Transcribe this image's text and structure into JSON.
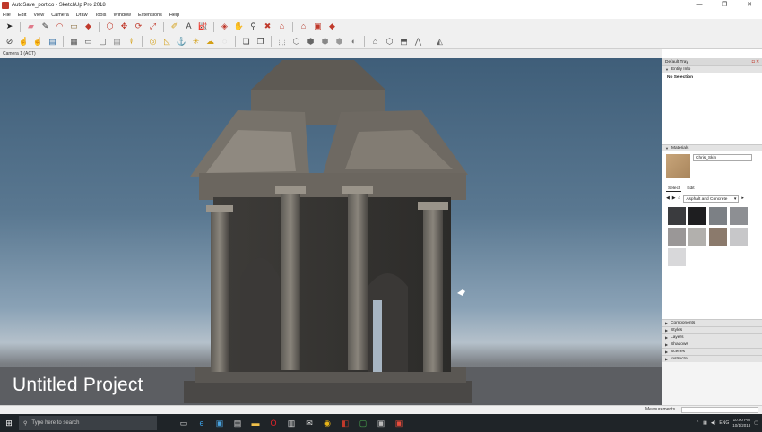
{
  "window": {
    "title": "AutoSave_portico - SketchUp Pro 2018",
    "controls": [
      "—",
      "❐",
      "✕"
    ]
  },
  "menu": [
    "File",
    "Edit",
    "View",
    "Camera",
    "Draw",
    "Tools",
    "Window",
    "Extensions",
    "Help"
  ],
  "toolbar_row1": [
    {
      "icon": "select-arrow-icon",
      "glyph": "➤",
      "color": "#222"
    },
    {
      "icon": "eraser-icon",
      "glyph": "▰",
      "color": "#e07a8a"
    },
    {
      "icon": "pencil-icon",
      "glyph": "✎",
      "color": "#333"
    },
    {
      "icon": "arc-icon",
      "glyph": "◠",
      "color": "#c0392b"
    },
    {
      "icon": "rectangle-icon",
      "glyph": "▭",
      "color": "#8a6d3b"
    },
    {
      "icon": "push-pull-icon",
      "glyph": "◆",
      "color": "#c0392b"
    },
    {
      "icon": "offset-icon",
      "glyph": "⬡",
      "color": "#c0392b"
    },
    {
      "icon": "move-icon",
      "glyph": "✥",
      "color": "#c0392b"
    },
    {
      "icon": "rotate-icon",
      "glyph": "⟳",
      "color": "#c0392b"
    },
    {
      "icon": "scale-icon",
      "glyph": "⤢",
      "color": "#c0392b"
    },
    {
      "icon": "tape-measure-icon",
      "glyph": "✐",
      "color": "#d4a017"
    },
    {
      "icon": "text-icon",
      "glyph": "A",
      "color": "#444"
    },
    {
      "icon": "paint-bucket-icon",
      "glyph": "⛽",
      "color": "#d35400"
    },
    {
      "icon": "orbit-icon",
      "glyph": "◈",
      "color": "#c0392b"
    },
    {
      "icon": "pan-icon",
      "glyph": "✋",
      "color": "#444"
    },
    {
      "icon": "zoom-icon",
      "glyph": "⚲",
      "color": "#444"
    },
    {
      "icon": "zoom-extents-icon",
      "glyph": "✖",
      "color": "#c0392b"
    },
    {
      "icon": "warehouse-icon",
      "glyph": "⌂",
      "color": "#c0392b"
    },
    {
      "icon": "extension-warehouse-icon",
      "glyph": "⌂",
      "color": "#b03a2e"
    },
    {
      "icon": "layout-icon",
      "glyph": "▣",
      "color": "#c0392b"
    },
    {
      "icon": "ruby-icon",
      "glyph": "◆",
      "color": "#c0392b"
    }
  ],
  "toolbar_row2": [
    {
      "icon": "walk-icon",
      "glyph": "⊘",
      "color": "#444"
    },
    {
      "icon": "hand-icon",
      "glyph": "☝",
      "color": "#444"
    },
    {
      "icon": "hand-select-icon",
      "glyph": "☝",
      "color": "#2e6da4"
    },
    {
      "icon": "section-plane-icon",
      "glyph": "▤",
      "color": "#2e6da4"
    },
    {
      "icon": "display-section-icon",
      "glyph": "▦",
      "color": "#555"
    },
    {
      "icon": "window-icon",
      "glyph": "▭",
      "color": "#555"
    },
    {
      "icon": "frame-icon",
      "glyph": "▢",
      "color": "#555"
    },
    {
      "icon": "lock-icon",
      "glyph": "▤",
      "color": "#888"
    },
    {
      "icon": "funnel-icon",
      "glyph": "⍒",
      "color": "#d4a017"
    },
    {
      "icon": "circle-target-icon",
      "glyph": "◎",
      "color": "#d4a017"
    },
    {
      "icon": "triangle-ruler-icon",
      "glyph": "◺",
      "color": "#d4a017"
    },
    {
      "icon": "anchor-icon",
      "glyph": "⚓",
      "color": "#d4a017"
    },
    {
      "icon": "spark-icon",
      "glyph": "✳",
      "color": "#d4a017"
    },
    {
      "icon": "cloud-icon",
      "glyph": "☁",
      "color": "#d4a017"
    },
    {
      "icon": "ring-icon",
      "glyph": "◌",
      "color": "#bbb"
    },
    {
      "icon": "union-icon",
      "glyph": "❏",
      "color": "#444"
    },
    {
      "icon": "subtract-icon",
      "glyph": "❐",
      "color": "#444"
    },
    {
      "icon": "xray-icon",
      "glyph": "⬚",
      "color": "#666"
    },
    {
      "icon": "wireframe-icon",
      "glyph": "⬡",
      "color": "#666"
    },
    {
      "icon": "hidden-line-icon",
      "glyph": "⬢",
      "color": "#666"
    },
    {
      "icon": "shaded-icon",
      "glyph": "⬢",
      "color": "#888"
    },
    {
      "icon": "shaded-texture-icon",
      "glyph": "⬢",
      "color": "#999"
    },
    {
      "icon": "monochrome-icon",
      "glyph": "◐",
      "color": "#777"
    },
    {
      "icon": "home-view-icon",
      "glyph": "⌂",
      "color": "#555"
    },
    {
      "icon": "iso-view-icon",
      "glyph": "⬡",
      "color": "#555"
    },
    {
      "icon": "front-view-icon",
      "glyph": "⬒",
      "color": "#555"
    },
    {
      "icon": "sandbox-icon",
      "glyph": "⋀",
      "color": "#666"
    },
    {
      "icon": "terrain-icon",
      "glyph": "◭",
      "color": "#666"
    }
  ],
  "scene_tab": "Camera 1 (ACT)",
  "viewport": {
    "project_title": "Untitled Project"
  },
  "tray": {
    "title": "Default Tray",
    "entity_info": {
      "label": "Entity Info",
      "selection": "No Selection"
    },
    "materials": {
      "label": "Materials",
      "name": "Chris_Skin",
      "tabs": [
        "Select",
        "Edit"
      ],
      "library": "Asphalt and Concrete",
      "swatches": [
        "#3a3b3e",
        "#1e1e20",
        "#7c8085",
        "#8d8f93",
        "#9a9797",
        "#b2b0ad",
        "#8b7a6c",
        "#c7c7c9",
        "#d8d8da"
      ]
    },
    "collapsed_panels": [
      "Components",
      "Styles",
      "Layers",
      "Shadows",
      "Scenes",
      "Instructor"
    ]
  },
  "status": {
    "measurements_label": "Measurements"
  },
  "taskbar": {
    "search_placeholder": "Type here to search",
    "apps": [
      {
        "icon": "task-view-icon",
        "glyph": "▭",
        "color": "#ddd"
      },
      {
        "icon": "edge-icon",
        "glyph": "e",
        "color": "#3b9de1"
      },
      {
        "icon": "photos-icon",
        "glyph": "▣",
        "color": "#4aa3df"
      },
      {
        "icon": "store-icon",
        "glyph": "▤",
        "color": "#ddd"
      },
      {
        "icon": "folder-icon",
        "glyph": "▬",
        "color": "#f0c04a"
      },
      {
        "icon": "opera-icon",
        "glyph": "O",
        "color": "#e2232a"
      },
      {
        "icon": "explorer-icon",
        "glyph": "▥",
        "color": "#ddd"
      },
      {
        "icon": "mail-icon",
        "glyph": "✉",
        "color": "#ddd"
      },
      {
        "icon": "chrome-icon",
        "glyph": "◉",
        "color": "#e8b417"
      },
      {
        "icon": "sketchup-icon",
        "glyph": "◧",
        "color": "#c0392b"
      },
      {
        "icon": "app-green-icon",
        "glyph": "▢",
        "color": "#4caf50"
      },
      {
        "icon": "photoshop-icon",
        "glyph": "▣",
        "color": "#bbb"
      },
      {
        "icon": "red-app-icon",
        "glyph": "▣",
        "color": "#e74c3c"
      }
    ],
    "lang": "ENG",
    "time": "10:00 PM",
    "date": "10/1/2018"
  }
}
